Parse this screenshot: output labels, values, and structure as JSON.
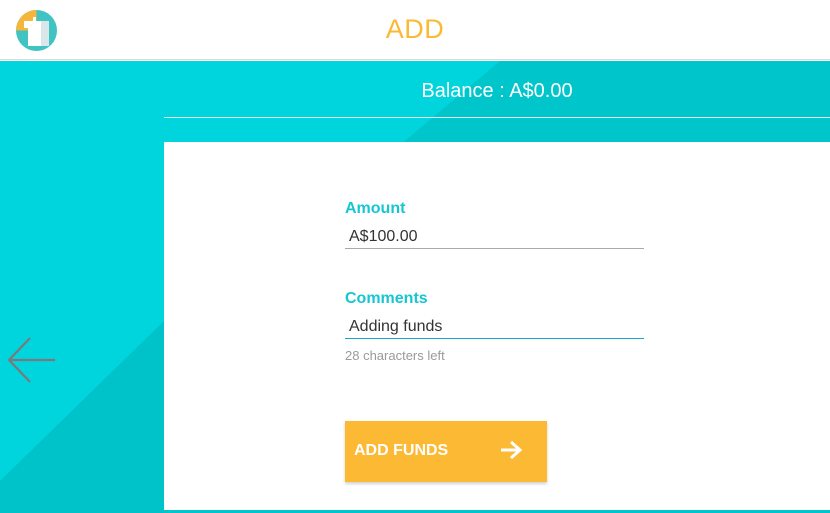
{
  "header": {
    "title": "ADD",
    "logo_icon": "wallet-app-logo-icon"
  },
  "balance": {
    "text": "Balance : A$0.00"
  },
  "form": {
    "amount_label": "Amount",
    "amount_value": "A$100.00",
    "comments_label": "Comments",
    "comments_value": "Adding funds",
    "comments_helper": "28 characters left",
    "submit_label": "ADD FUNDS",
    "submit_icon": "arrow-right-icon"
  },
  "nav": {
    "back_icon": "arrow-left-icon"
  },
  "colors": {
    "accent": "#fbb934",
    "teal": "#00d4dc",
    "teal_dark": "#00c4cb",
    "label": "#17c6d3"
  }
}
